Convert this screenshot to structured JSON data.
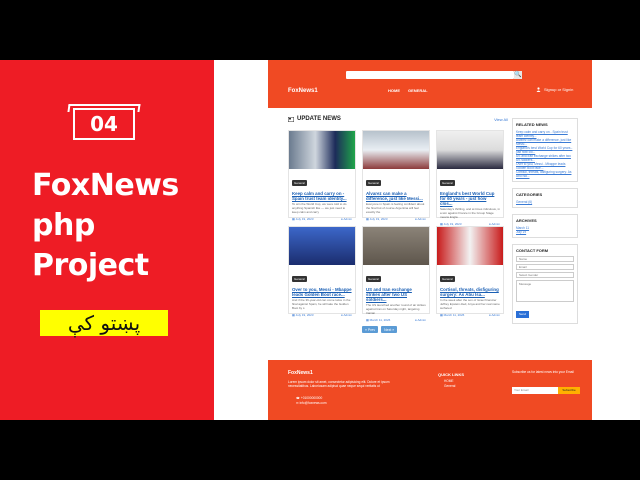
{
  "promo": {
    "episode": "04",
    "line1": "FoxNews",
    "line2": "php",
    "line3": "Project",
    "pashto": "پښتو کې"
  },
  "site": {
    "brand": "FoxNews1",
    "nav": [
      "HOME",
      "GENERAL"
    ],
    "login": "Signup or Signin",
    "search_button": "🔍"
  },
  "main": {
    "section_title": "UPDATE NEWS",
    "view_all": "View All",
    "cards": [
      {
        "category": "General",
        "title": "Keep calm and carry on - Spain trust team identity...",
        "desc": "To win the World Cup, we were told to do anything Spanish like — we just need to keep calm and carry",
        "date": "July 19, 2023",
        "author": "Admin",
        "thumb": "soccer-green"
      },
      {
        "category": "General",
        "title": "Alvarez can make a difference, just like Messi...",
        "desc": "Everyone in Spain is feeling confident about the final but of course Argentina will feel exactly the",
        "date": "July 19, 2023",
        "author": "Admin",
        "thumb": "soccer-team"
      },
      {
        "category": "General",
        "title": "England's best World Cup for 60 years - just how clos...",
        "desc": "Saturday's thrilling, and at times ridiculous, in a win against France in the Group Stage means Engla",
        "date": "July 19, 2023",
        "author": "Admin",
        "thumb": "england"
      },
      {
        "category": "General",
        "title": "Over to you, Messi - Mbappe leads Golden Boot race...",
        "desc": "And if the 36-year-old can come twice in the final against Spain, he will take the Golden Boot by s",
        "date": "July 19, 2023",
        "author": "Admin",
        "thumb": "mbappe"
      },
      {
        "category": "General",
        "title": "US and Iran exchange strikes after two US soldiers...",
        "desc": "The US launched another round of air strikes against Iran on Saturday night, targeting Iranian",
        "date": "March 11, 2026",
        "author": "Admin",
        "thumb": "rubble"
      },
      {
        "category": "General",
        "title": "Cortisol, threats, disfiguring surgery: As Abu Isa...",
        "desc": "In the week after the son of Israel financier Jeffrey Epstein died, Anya and her real name surfaced",
        "date": "March 11, 2026",
        "author": "Admin",
        "thumb": "red-face"
      }
    ],
    "pager": [
      "« Prev",
      "Next »"
    ]
  },
  "sidebar": {
    "related_title": "RELATED NEWS",
    "related": [
      "Keep calm and carry on - Spain trust team identity...",
      "Alvarez can make a difference, just like Messi...",
      "England's best World Cup for 60 years - just how clo...",
      "US and Iran exchange strikes after two US soldiers...",
      "Over to you, Messi - Mbappe leads Golden Boot race...",
      "Cortisol, threats, disfiguring surgery: As Abu Isa..."
    ],
    "categories_title": "CATEGORIES",
    "categories": [
      "General (6)"
    ],
    "archives_title": "ARCHIVES",
    "archives": [
      "March 11",
      "July 19"
    ],
    "contact_title": "CONTACT FORM",
    "contact_fields": [
      "Name",
      "Email",
      "Select Gender",
      "Message"
    ],
    "send": "Send"
  },
  "footer": {
    "brand": "FoxNews1",
    "desc": "Lorem ipsum dolor sit amet, consectetur adipisicing elit. Dolore et ipsum necessitatibus. Laboriosam adipisci quae neque sequi veritatis ut",
    "phone": "+01000000000",
    "email": "info@foxnews.com",
    "quick_links_title": "QUICK LINKS",
    "quick_links": [
      "HOME",
      "General"
    ],
    "newsletter": "Subscribe us for latest news into your Email",
    "email_placeholder": "Your Email",
    "subscribe": "Subscribe"
  }
}
